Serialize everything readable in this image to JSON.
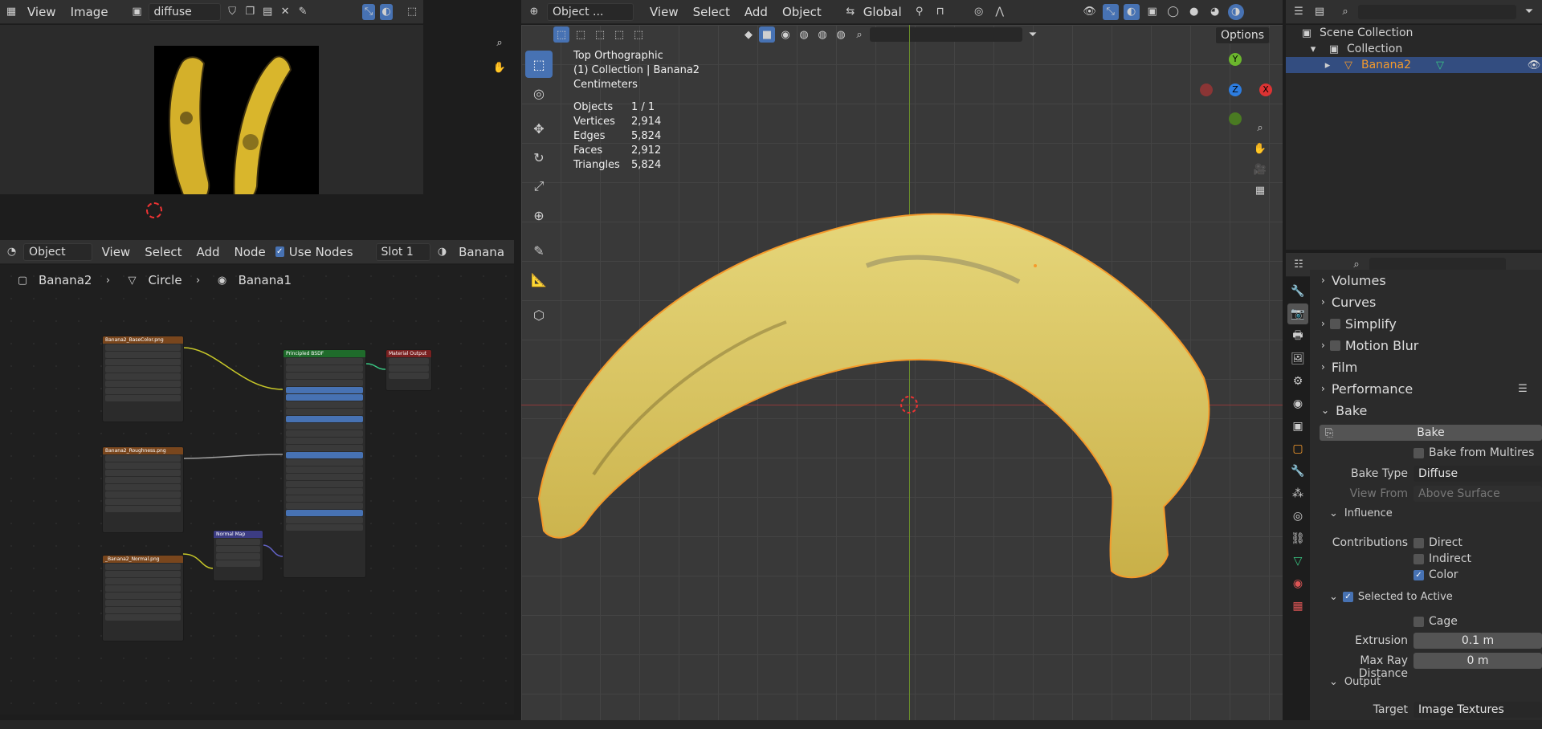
{
  "image_editor": {
    "menus": [
      "View",
      "Image"
    ],
    "image_name": "diffuse"
  },
  "node_editor": {
    "mode": "Object",
    "menus": [
      "View",
      "Select",
      "Add",
      "Node"
    ],
    "use_nodes_label": "Use Nodes",
    "slot": "Slot 1",
    "material": "Banana",
    "breadcrumb": [
      "Banana2",
      "Circle",
      "Banana1"
    ],
    "nodes": {
      "base_color": "Banana2_BaseColor.png",
      "roughness": "Banana2_Roughness.png",
      "normal": "_Banana2_Normal.png",
      "bsdf": "Principled BSDF",
      "normal_map": "Normal Map",
      "output": "Material Output"
    }
  },
  "viewport": {
    "mode": "Object ...",
    "menus": [
      "View",
      "Select",
      "Add",
      "Object"
    ],
    "transform": "Global",
    "options": "Options",
    "view_name": "Top Orthographic",
    "collection_line": "(1) Collection | Banana2",
    "units": "Centimeters",
    "stats": [
      {
        "k": "Objects",
        "v": "1 / 1"
      },
      {
        "k": "Vertices",
        "v": "2,914"
      },
      {
        "k": "Edges",
        "v": "5,824"
      },
      {
        "k": "Faces",
        "v": "2,912"
      },
      {
        "k": "Triangles",
        "v": "5,824"
      }
    ],
    "gizmo": {
      "x": "X",
      "y": "Y",
      "z": "Z"
    }
  },
  "outliner": {
    "scene": "Scene Collection",
    "collection": "Collection",
    "object": "Banana2"
  },
  "properties": {
    "sections": [
      "Volumes",
      "Curves",
      "Simplify",
      "Motion Blur",
      "Film",
      "Performance",
      "Bake"
    ],
    "bake_button": "Bake",
    "bake_from_multires": "Bake from Multires",
    "bake_type_label": "Bake Type",
    "bake_type": "Diffuse",
    "view_from_label": "View From",
    "view_from": "Above Surface",
    "influence": "Influence",
    "contributions_label": "Contributions",
    "direct": "Direct",
    "indirect": "Indirect",
    "color": "Color",
    "selected_to_active": "Selected to Active",
    "cage": "Cage",
    "extrusion_label": "Extrusion",
    "extrusion": "0.1 m",
    "max_ray_label": "Max Ray Distance",
    "max_ray": "0 m",
    "output": "Output",
    "target_label": "Target",
    "target": "Image Textures"
  },
  "colors": {
    "accent": "#4772b3",
    "selection": "#f59a2b"
  }
}
